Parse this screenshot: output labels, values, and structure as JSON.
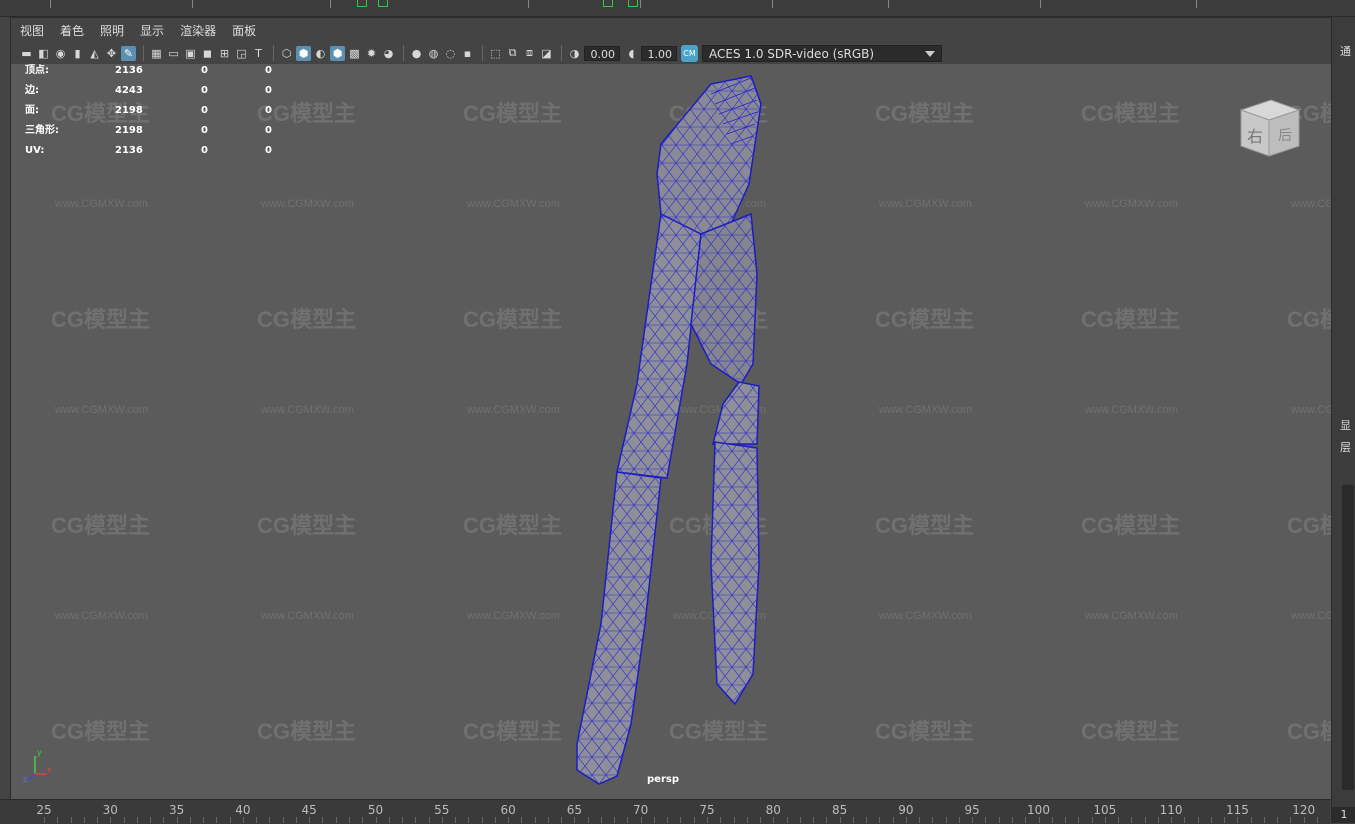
{
  "menu": [
    "视图",
    "着色",
    "照明",
    "显示",
    "渲染器",
    "面板"
  ],
  "toolbar": {
    "exposure_value": "0.00",
    "gamma_value": "1.00",
    "color_space": "ACES 1.0 SDR-video (sRGB)"
  },
  "hud": {
    "rows": [
      {
        "label": "顶点:",
        "v1": "2136",
        "v2": "0",
        "v3": "0"
      },
      {
        "label": "边:",
        "v1": "4243",
        "v2": "0",
        "v3": "0"
      },
      {
        "label": "面:",
        "v1": "2198",
        "v2": "0",
        "v3": "0"
      },
      {
        "label": "三角形:",
        "v1": "2198",
        "v2": "0",
        "v3": "0"
      },
      {
        "label": "UV:",
        "v1": "2136",
        "v2": "0",
        "v3": "0"
      }
    ]
  },
  "camera_label": "persp",
  "viewcube": {
    "front": "右",
    "side": "后"
  },
  "axis": {
    "x": "x",
    "y": "y",
    "z": "z"
  },
  "watermark": {
    "logo": "CG模型主",
    "url": "www.CGMXW.com"
  },
  "timeline": {
    "ticks": [
      "25",
      "30",
      "35",
      "40",
      "45",
      "50",
      "55",
      "60",
      "65",
      "70",
      "75",
      "80",
      "85",
      "90",
      "95",
      "100",
      "105",
      "110",
      "115",
      "120"
    ]
  },
  "right_panel": {
    "t1": "通",
    "t2": "显",
    "t3": "层",
    "frame": "1"
  },
  "colors": {
    "wire": "#2020c8",
    "mesh": "#8f8f9a",
    "viewport_bg": "#5b5b5b",
    "active_icon": "#5c8fb0"
  }
}
